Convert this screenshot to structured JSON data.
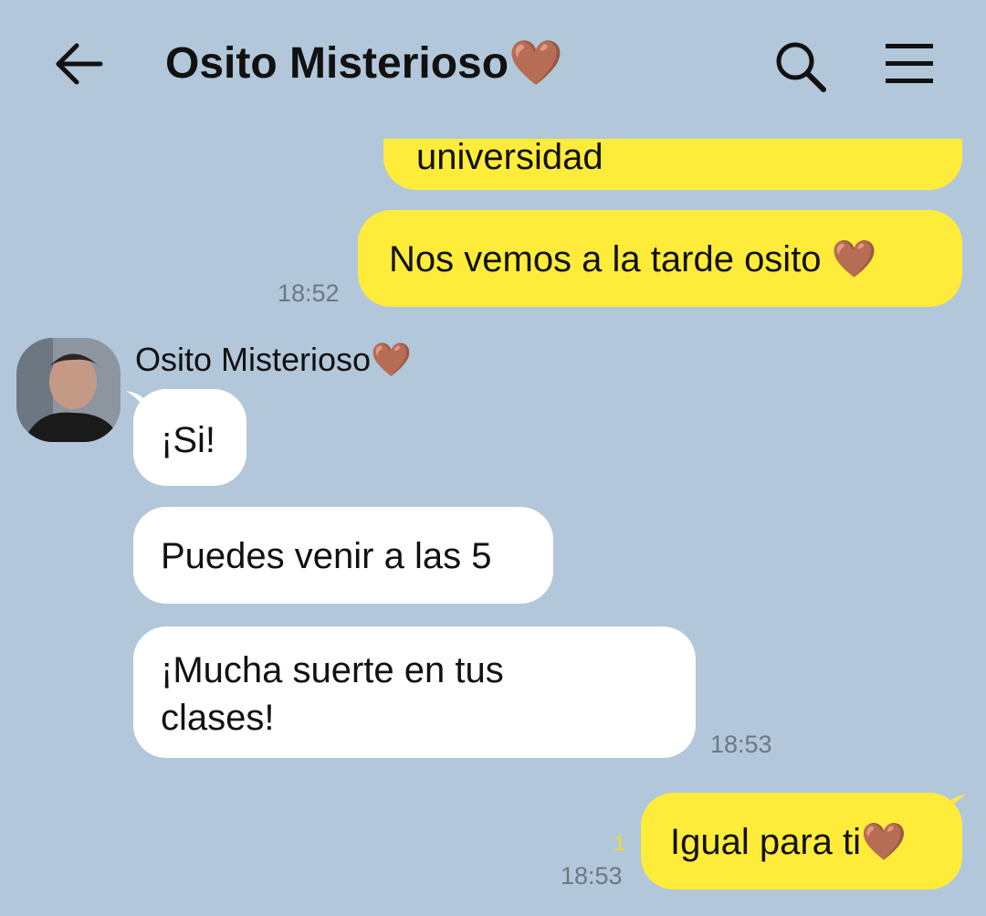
{
  "header": {
    "title": "Osito Misterioso🤎",
    "back_icon": "arrow-left-icon",
    "search_icon": "search-icon",
    "menu_icon": "hamburger-menu-icon"
  },
  "messages": [
    {
      "from": "me",
      "text": "universidad",
      "time": ""
    },
    {
      "from": "me",
      "text": "Nos vemos a la tarde osito 🤎",
      "time": "18:52"
    },
    {
      "from": "them",
      "sender": "Osito Misterioso🤎",
      "text": "¡Si!",
      "time": ""
    },
    {
      "from": "them",
      "text": "Puedes venir a las 5",
      "time": ""
    },
    {
      "from": "them",
      "text_line1": "¡Mucha suerte en tus",
      "text_line2": "clases!",
      "time": "18:53"
    },
    {
      "from": "me",
      "text": "Igual para ti🤎",
      "unread": "1",
      "time": "18:53"
    }
  ],
  "colors": {
    "background": "#b2c7da",
    "my_bubble": "#ffec3a",
    "their_bubble": "#ffffff",
    "unread_count": "#f5d92e"
  }
}
